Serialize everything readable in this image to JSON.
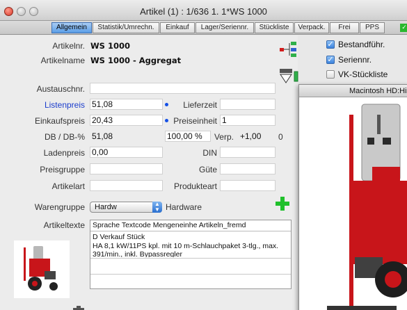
{
  "window": {
    "title": "Artikel (1) : 1/636 1.     1*WS 1000"
  },
  "tabs": [
    {
      "label": "Allgemein",
      "active": true
    },
    {
      "label": "Statistik/Umrechn."
    },
    {
      "label": "Einkauf"
    },
    {
      "label": "Lager/Seriennr."
    },
    {
      "label": "Stückliste"
    },
    {
      "label": "Verpack."
    },
    {
      "label": "Frei"
    },
    {
      "label": "PPS"
    }
  ],
  "form": {
    "artikelnr": {
      "label": "Artikelnr.",
      "value": "WS 1000"
    },
    "artikelname": {
      "label": "Artikelname",
      "value": "WS 1000 - Aggregat"
    },
    "austauschnr": {
      "label": "Austauschnr.",
      "value": ""
    },
    "listenpreis": {
      "label": "Listenpreis",
      "value": "51,08"
    },
    "lieferzeit": {
      "label": "Lieferzeit",
      "value": ""
    },
    "einkaufspreis": {
      "label": "Einkaufspreis",
      "value": "20,43"
    },
    "preiseinheit": {
      "label": "Preiseinheit",
      "value": "1"
    },
    "db": {
      "label": "DB / DB-%",
      "value": "51,08",
      "percent": "100,00 %",
      "verp_label": "Verp.",
      "verp_value": "+1,00",
      "verp_extra": "0"
    },
    "ladenpreis": {
      "label": "Ladenpreis",
      "value": "0,00"
    },
    "din": {
      "label": "DIN",
      "value": ""
    },
    "preisgruppe": {
      "label": "Preisgruppe",
      "value": ""
    },
    "guete": {
      "label": "Güte",
      "value": ""
    },
    "artikelart": {
      "label": "Artikelart",
      "value": ""
    },
    "produktart": {
      "label": "Produkteart",
      "value": ""
    },
    "warengruppe": {
      "label": "Warengruppe",
      "selected": "Hardw",
      "desc": "Hardware"
    },
    "artikeltexte": {
      "label": "Artikeltexte",
      "header": "Sprache  Textcode   Mengeneinhe Artikeln_fremd",
      "row1": "D           Verkauf      Stück",
      "row2": "HA 8,1 kW/11PS kpl. mit 10 m-Schlauchpaket 3-tlg., max.",
      "row3": "391/min., inkl. Bypassregler"
    }
  },
  "options": {
    "bestandfuehr": {
      "label": "Bestandführ.",
      "checked": true
    },
    "seriennr": {
      "label": "Seriennr.",
      "checked": true
    },
    "vk_stueckliste": {
      "label": "VK-Stückliste",
      "checked": false
    }
  },
  "image_window": {
    "title": "Macintosh HD:Hi"
  },
  "colors": {
    "accent": "#5a9de6",
    "label_link": "#1a3ccc",
    "plus": "#1fc02b",
    "product_red": "#c8151a"
  }
}
